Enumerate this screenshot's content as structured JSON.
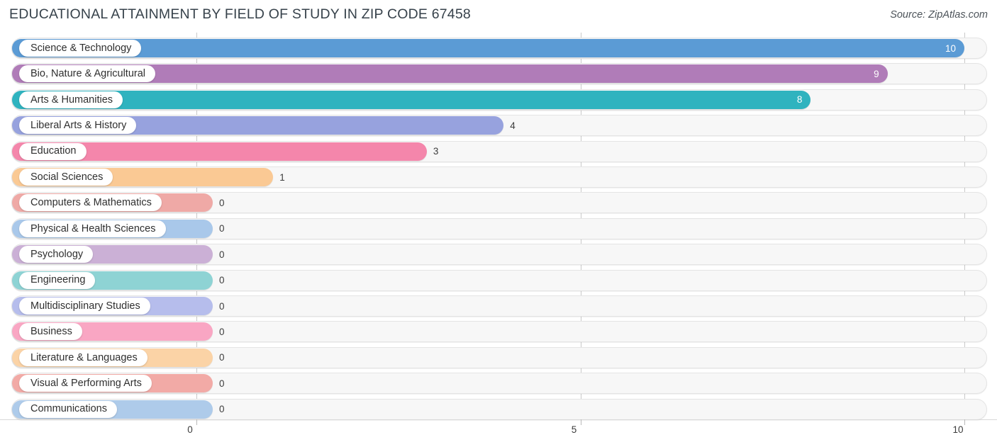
{
  "header": {
    "title": "EDUCATIONAL ATTAINMENT BY FIELD OF STUDY IN ZIP CODE 67458",
    "source": "Source: ZipAtlas.com"
  },
  "chart_data": {
    "type": "bar",
    "orientation": "horizontal",
    "title": "EDUCATIONAL ATTAINMENT BY FIELD OF STUDY IN ZIP CODE 67458",
    "xlabel": "",
    "ylabel": "",
    "xlim": [
      0,
      10
    ],
    "xticks": [
      0,
      5,
      10
    ],
    "xtick_labels": [
      "0",
      "5",
      "10"
    ],
    "grid": true,
    "legend": false,
    "categories": [
      "Science & Technology",
      "Bio, Nature & Agricultural",
      "Arts & Humanities",
      "Liberal Arts & History",
      "Education",
      "Social Sciences",
      "Computers & Mathematics",
      "Physical & Health Sciences",
      "Psychology",
      "Engineering",
      "Multidisciplinary Studies",
      "Business",
      "Literature & Languages",
      "Visual & Performing Arts",
      "Communications"
    ],
    "values": [
      10,
      9,
      8,
      4,
      3,
      1,
      0,
      0,
      0,
      0,
      0,
      0,
      0,
      0,
      0
    ],
    "value_labels": [
      "10",
      "9",
      "8",
      "4",
      "3",
      "1",
      "0",
      "0",
      "0",
      "0",
      "0",
      "0",
      "0",
      "0",
      "0"
    ],
    "colors": [
      "#5b9bd5",
      "#b07cb8",
      "#2fb3bf",
      "#97a2de",
      "#f486ab",
      "#fac994",
      "#efa9a6",
      "#a9c8ea",
      "#cbb0d6",
      "#8ed3d4",
      "#b6bdec",
      "#f9a6c3",
      "#fbd3a6",
      "#f2aaa6",
      "#aecbea"
    ]
  },
  "axis": {
    "tick_labels": [
      "0",
      "5",
      "10"
    ]
  }
}
